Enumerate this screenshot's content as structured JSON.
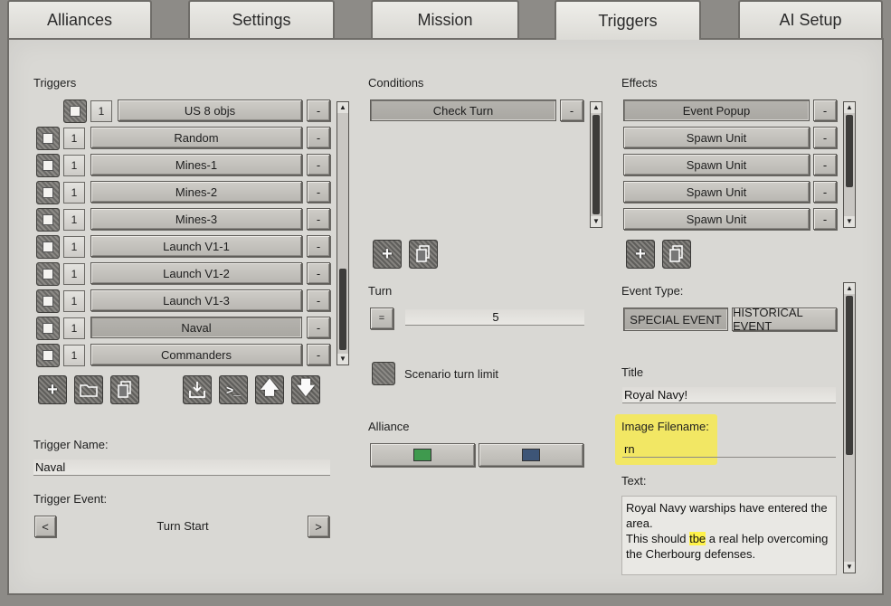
{
  "tabs": [
    {
      "label": "Alliances"
    },
    {
      "label": "Settings"
    },
    {
      "label": "Mission"
    },
    {
      "label": "Triggers"
    },
    {
      "label": "AI Setup"
    }
  ],
  "triggers": {
    "title": "Triggers",
    "rows": [
      {
        "num": "1",
        "name": "US 8 objs",
        "del": "-"
      },
      {
        "num": "1",
        "name": "Random",
        "del": "-"
      },
      {
        "num": "1",
        "name": "Mines-1",
        "del": "-"
      },
      {
        "num": "1",
        "name": "Mines-2",
        "del": "-"
      },
      {
        "num": "1",
        "name": "Mines-3",
        "del": "-"
      },
      {
        "num": "1",
        "name": "Launch V1-1",
        "del": "-"
      },
      {
        "num": "1",
        "name": "Launch V1-2",
        "del": "-"
      },
      {
        "num": "1",
        "name": "Launch V1-3",
        "del": "-"
      },
      {
        "num": "1",
        "name": "Naval",
        "del": "-"
      },
      {
        "num": "1",
        "name": "Commanders",
        "del": "-"
      }
    ],
    "name_label": "Trigger Name:",
    "name_value": "Naval",
    "event_label": "Trigger Event:",
    "event_value": "Turn Start",
    "prev": "<",
    "next": ">"
  },
  "conditions": {
    "title": "Conditions",
    "rows": [
      {
        "name": "Check Turn",
        "del": "-"
      }
    ],
    "turn_label": "Turn",
    "turn_op": "=",
    "turn_value": "5",
    "turn_limit_label": "Scenario turn limit",
    "alliance_label": "Alliance",
    "alliance_colors": [
      "#3f9a4e",
      "#3d5577"
    ]
  },
  "effects": {
    "title": "Effects",
    "rows": [
      {
        "name": "Event Popup",
        "del": "-"
      },
      {
        "name": "Spawn Unit",
        "del": "-"
      },
      {
        "name": "Spawn Unit",
        "del": "-"
      },
      {
        "name": "Spawn Unit",
        "del": "-"
      },
      {
        "name": "Spawn Unit",
        "del": "-"
      }
    ],
    "event_type_label": "Event Type:",
    "event_type_special": "SPECIAL EVENT",
    "event_type_historical": "HISTORICAL EVENT",
    "title_label": "Title",
    "title_value": "Royal Navy!",
    "image_label": "Image Filename:",
    "image_value": "rn",
    "text_label": "Text:",
    "text_line1": "Royal Navy warships have entered the area.",
    "text_line2_a": "This should ",
    "text_line2_hl": "tbe",
    "text_line2_b": " a real help overcoming the Cherbourg defenses."
  },
  "icons": {
    "add": "plus-icon",
    "folder": "folder-icon",
    "copy": "copy-icon",
    "import": "import-icon",
    "console": "console-icon",
    "up": "arrow-up-icon",
    "down": "arrow-down-icon"
  }
}
